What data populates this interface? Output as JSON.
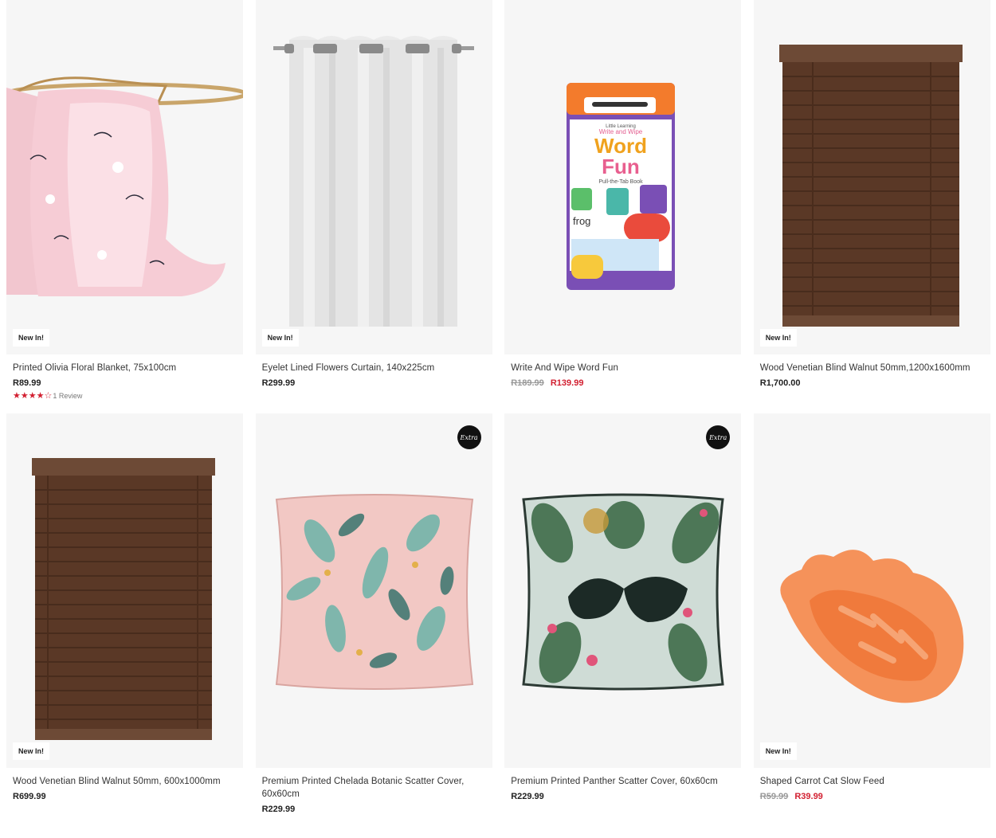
{
  "products": [
    {
      "title": "Printed Olivia Floral Blanket, 75x100cm",
      "price": "R89.99",
      "badge": "New In!",
      "rating": 4,
      "reviews": "1 Review"
    },
    {
      "title": "Eyelet Lined Flowers Curtain, 140x225cm",
      "price": "R299.99",
      "badge": "New In!"
    },
    {
      "title": "Write And Wipe Word Fun",
      "was_price": "R189.99",
      "sale_price": "R139.99"
    },
    {
      "title": "Wood Venetian Blind Walnut 50mm,1200x1600mm",
      "price": "R1,700.00",
      "badge": "New In!"
    },
    {
      "title": "Wood Venetian Blind Walnut 50mm, 600x1000mm",
      "price": "R699.99",
      "badge": "New In!"
    },
    {
      "title": "Premium Printed Chelada Botanic Scatter Cover, 60x60cm",
      "price": "R229.99",
      "extra_badge": "Extra"
    },
    {
      "title": "Premium Printed Panther Scatter Cover, 60x60cm",
      "price": "R229.99",
      "extra_badge": "Extra"
    },
    {
      "title": "Shaped Carrot Cat Slow Feed",
      "was_price": "R59.99",
      "sale_price": "R39.99",
      "badge": "New In!"
    }
  ],
  "book_cover": {
    "line1": "Little Learning",
    "line2": "Write and Wipe",
    "word1": "Word",
    "word2": "Fun",
    "sub": "Pull-the-Tab Book",
    "sample": "frog"
  },
  "colors": {
    "sale": "#d21f30",
    "card_bg": "#f6f6f6"
  }
}
